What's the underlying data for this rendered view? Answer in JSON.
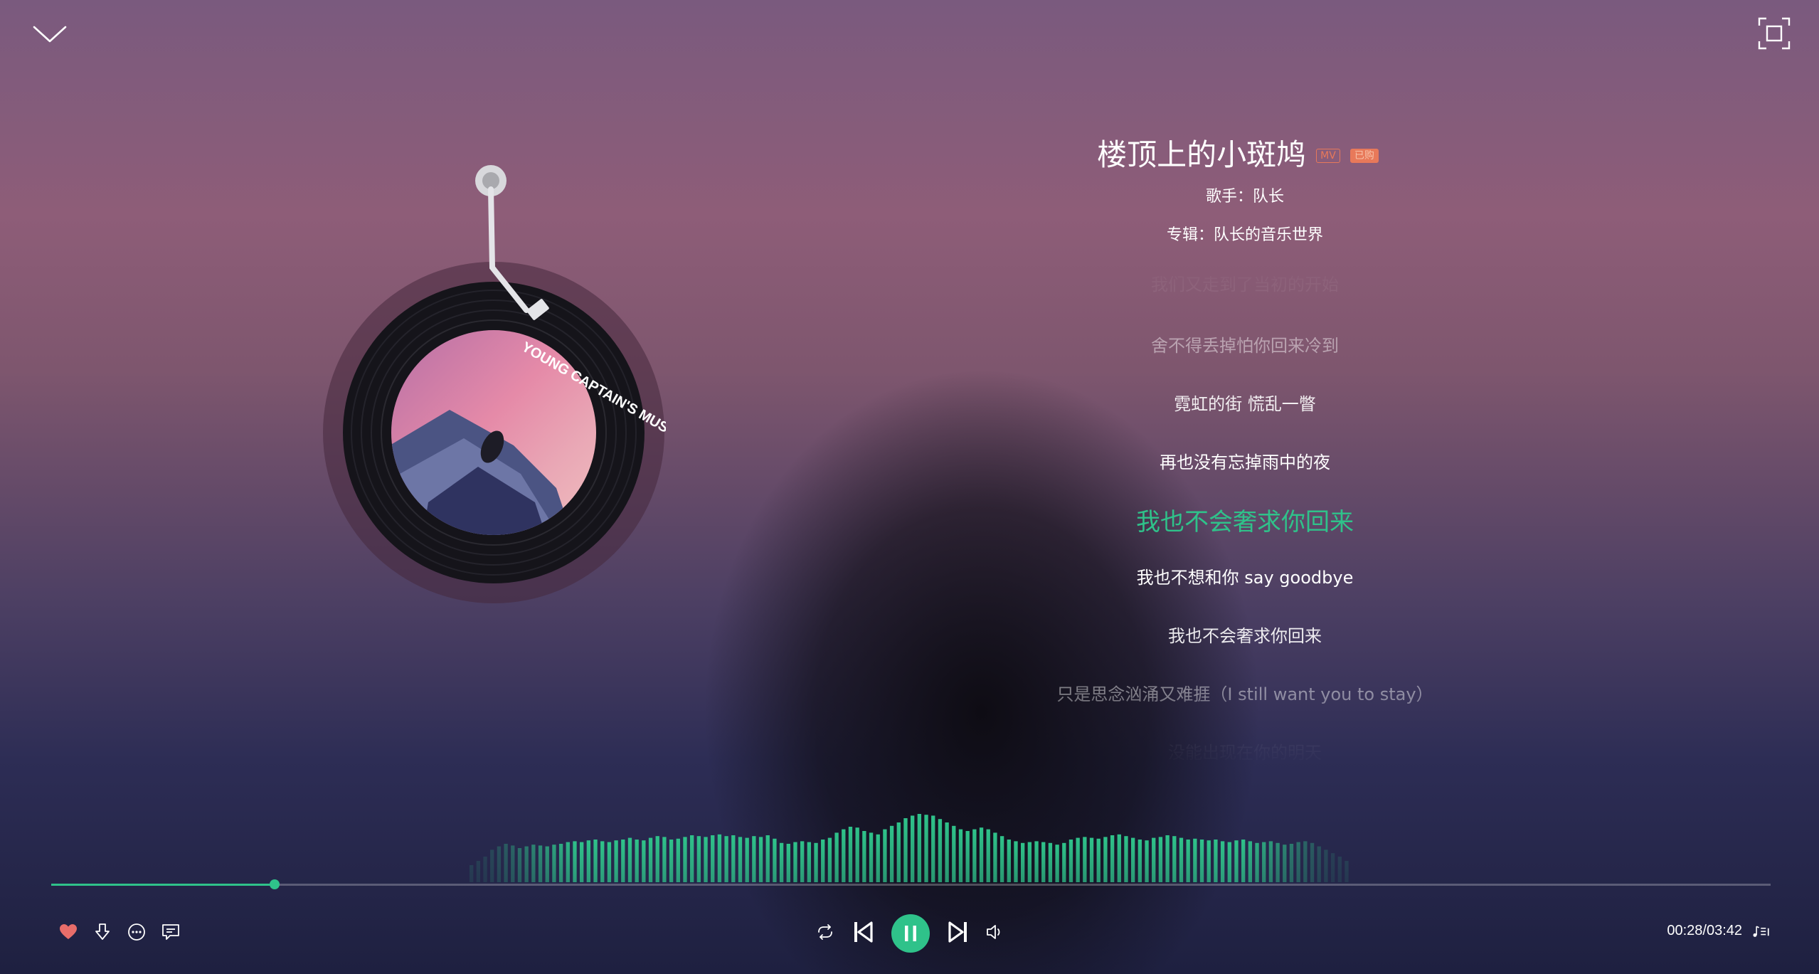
{
  "song": {
    "title": "楼顶上的小斑鸠",
    "tags": [
      "MV",
      "已购"
    ],
    "artist_line": "歌手：队长",
    "album_line": "专辑：队长的音乐世界"
  },
  "album_art_text": "YOUNG CAPTAIN'S MUSIC WORLD",
  "lyrics": [
    "我们又走到了当初的开始",
    "舍不得丢掉怕你回来冷到",
    "霓虹的街 慌乱一瞥",
    "再也没有忘掉雨中的夜",
    "我也不会奢求你回来",
    "我也不想和你 say goodbye",
    "我也不会奢求你回来",
    "只是思念汹涌又难捱（I still want you to stay）",
    "没能出现在你的明天"
  ],
  "lyric_opacity": [
    0.15,
    0.45,
    0.9,
    1.0,
    1.0,
    1.0,
    0.9,
    0.45,
    0.15
  ],
  "active_lyric_index": 4,
  "playback": {
    "current_time": "00:28",
    "total_time": "03:42",
    "time_display": "00:28/03:42",
    "progress": 0.13,
    "liked": true,
    "state": "playing"
  },
  "icons": {
    "collapse": "chevron-down-icon",
    "fullscreen": "fullscreen-icon",
    "like": "heart-icon",
    "download": "download-icon",
    "more": "more-icon",
    "comment": "comment-icon",
    "loop": "loop-icon",
    "prev": "skip-previous-icon",
    "play_pause": "pause-icon",
    "next": "skip-next-icon",
    "volume": "volume-icon",
    "playlist": "playlist-icon"
  },
  "colors": {
    "accent": "#2fc28a",
    "like": "#e86d6a",
    "tag": "#e8795a"
  },
  "spectrum_levels": [
    0.2,
    0.25,
    0.3,
    0.38,
    0.42,
    0.45,
    0.43,
    0.4,
    0.42,
    0.44,
    0.43,
    0.42,
    0.44,
    0.45,
    0.47,
    0.48,
    0.47,
    0.49,
    0.5,
    0.48,
    0.47,
    0.49,
    0.5,
    0.52,
    0.5,
    0.49,
    0.52,
    0.54,
    0.53,
    0.5,
    0.51,
    0.53,
    0.55,
    0.54,
    0.53,
    0.55,
    0.56,
    0.54,
    0.55,
    0.53,
    0.52,
    0.54,
    0.53,
    0.55,
    0.51,
    0.46,
    0.45,
    0.47,
    0.48,
    0.47,
    0.46,
    0.5,
    0.52,
    0.58,
    0.62,
    0.65,
    0.64,
    0.6,
    0.58,
    0.56,
    0.62,
    0.66,
    0.7,
    0.75,
    0.78,
    0.8,
    0.79,
    0.78,
    0.74,
    0.7,
    0.66,
    0.62,
    0.6,
    0.62,
    0.64,
    0.62,
    0.58,
    0.54,
    0.5,
    0.48,
    0.46,
    0.47,
    0.48,
    0.47,
    0.46,
    0.44,
    0.46,
    0.5,
    0.52,
    0.53,
    0.52,
    0.51,
    0.53,
    0.55,
    0.56,
    0.54,
    0.52,
    0.5,
    0.49,
    0.52,
    0.53,
    0.55,
    0.54,
    0.52,
    0.5,
    0.51,
    0.5,
    0.49,
    0.5,
    0.48,
    0.47,
    0.49,
    0.5,
    0.48,
    0.46,
    0.47,
    0.48,
    0.46,
    0.44,
    0.45,
    0.47,
    0.48,
    0.46,
    0.42,
    0.38,
    0.34,
    0.3,
    0.25
  ]
}
